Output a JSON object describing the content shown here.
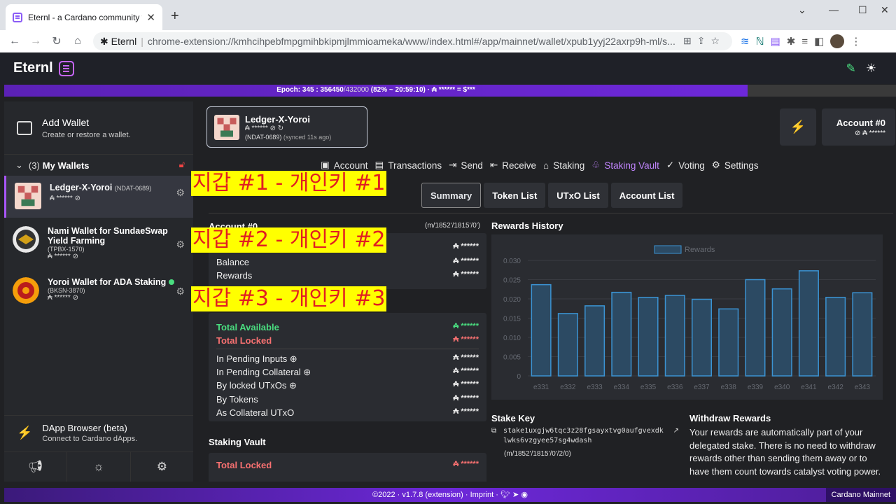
{
  "browser": {
    "tab_title": "Eternl - a Cardano community w",
    "site": "Eternl",
    "url": "chrome-extension://kmhcihpebfmpgmihbkipmjlmmioameka/www/index.html#/app/mainnet/wallet/xpub1yyj22axrp9h-ml/s..."
  },
  "header": {
    "logo": "Eternl"
  },
  "epoch": {
    "bold": "Epoch: 345 : 356450",
    "dim": "/432000",
    "rest": " (82% ~ 20:59:10) · ₳ ****** = $***"
  },
  "sidebar": {
    "add_wallet_title": "Add Wallet",
    "add_wallet_sub": "Create or restore a wallet.",
    "my_wallets_count": "(3)",
    "my_wallets_label": "My Wallets",
    "wallets": [
      {
        "name": "Ledger-X-Yoroi",
        "tag": "(NDAT-0689)",
        "id": "",
        "balance": "₳ ******"
      },
      {
        "name": "Nami Wallet for SundaeSwap Yield Farming",
        "tag": "",
        "id": "(TPBX-1570)",
        "balance": "₳ ******"
      },
      {
        "name": "Yoroi Wallet for ADA Staking",
        "tag": "",
        "id": "(BKSN-3870)",
        "balance": "₳ ******"
      }
    ],
    "dapp_title": "DApp Browser (beta)",
    "dapp_sub": "Connect to Cardano dApps."
  },
  "account_card": {
    "name": "Ledger-X-Yoroi",
    "balance": "₳ ******",
    "id": "(NDAT-0689)",
    "synced": "(synced 11s ago)"
  },
  "account_button": {
    "title": "Account #0",
    "balance": "₳ ******"
  },
  "tabs": [
    "Account",
    "Transactions",
    "Send",
    "Receive",
    "Staking",
    "Staking Vault",
    "Voting",
    "Settings"
  ],
  "sub_tabs": [
    "Summary",
    "Token List",
    "UTxO List",
    "Account List"
  ],
  "account_section": {
    "title": "Account #0",
    "path": "(m/1852'/1815'/0')",
    "rows": [
      {
        "label": "",
        "value": "₳ ******"
      },
      {
        "label": "Balance",
        "value": "₳ ******"
      },
      {
        "label": "Rewards",
        "value": "₳ ******"
      }
    ]
  },
  "available": {
    "total_available": "Total Available",
    "total_available_value": "₳ ******",
    "total_locked": "Total Locked",
    "total_locked_value": "₳ ******",
    "rows": [
      {
        "label": "In Pending Inputs ⊕",
        "value": "₳ ******"
      },
      {
        "label": "In Pending Collateral ⊕",
        "value": "₳ ******"
      },
      {
        "label": "By locked UTxOs ⊕",
        "value": "₳ ******"
      },
      {
        "label": "By Tokens",
        "value": "₳ ******"
      },
      {
        "label": "As Collateral UTxO",
        "value": "₳ ******"
      }
    ]
  },
  "staking_vault": {
    "title": "Staking Vault",
    "total_locked": "Total Locked",
    "total_locked_value": "₳ ******"
  },
  "chart_data": {
    "type": "bar",
    "title": "Rewards History",
    "xlabel": "",
    "ylabel": "",
    "series": [
      {
        "name": "Rewards",
        "values": [
          0.0237,
          0.0162,
          0.0182,
          0.0217,
          0.0204,
          0.0209,
          0.0199,
          0.0174,
          0.025,
          0.0226,
          0.0273,
          0.0204,
          0.0216
        ]
      }
    ],
    "categories": [
      "e331",
      "e332",
      "e333",
      "e334",
      "e335",
      "e336",
      "e337",
      "e338",
      "e339",
      "e340",
      "e341",
      "e342",
      "e343"
    ],
    "yticks": [
      "0.030",
      "0.025",
      "0.020",
      "0.015",
      "0.010",
      "0.005",
      "0"
    ],
    "ylim": [
      0,
      0.03
    ],
    "grid": true,
    "legend": "top",
    "colors": {
      "bar_fill": "#2c4a63",
      "bar_stroke": "#3b93d2",
      "grid": "#3a3c42",
      "tick": "#666a72"
    }
  },
  "stake_key": {
    "title": "Stake Key",
    "key_line1": "stake1uxgjw6tqc3z28fgsayxtvg0aufgvexdk",
    "key_line2": "lwks6vzgyee57sg4wdash",
    "path": "(m/1852'/1815'/0'/2/0)"
  },
  "withdraw": {
    "title": "Withdraw Rewards",
    "text": "Your rewards are automatically part of your delegated stake. There is no need to withdraw rewards other than sending them away or to have them count towards catalyst voting power."
  },
  "overlays": [
    "지갑 #1 - 개인키 #1",
    "지갑 #2 - 개인키 #2",
    "지갑 #3 - 개인키 #3"
  ],
  "footer": {
    "text": "©2022 · v1.7.8 (extension) · Imprint ·",
    "network": "Cardano Mainnet"
  }
}
